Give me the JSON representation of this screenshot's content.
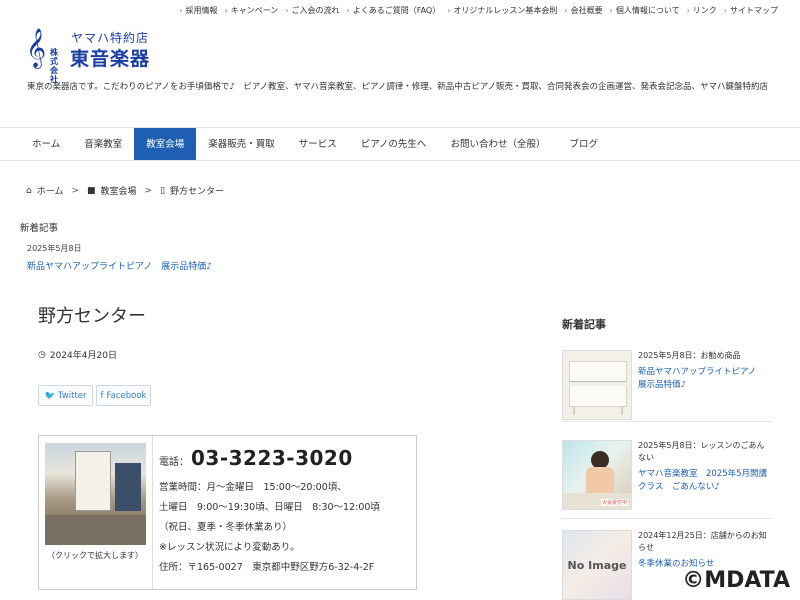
{
  "top_nav": [
    "採用情報",
    "キャンペーン",
    "ご入会の流れ",
    "よくあるご質問（FAQ）",
    "オリジナルレッスン基本会則",
    "会社概要",
    "個人情報について",
    "リンク",
    "サイトマップ"
  ],
  "logo": {
    "subtitle": "ヤマハ特約店",
    "corp": "株式会社",
    "name": "東音楽器"
  },
  "intro": "東京の楽器店です。こだわりのピアノをお手頃価格で♪　ピアノ教室、ヤマハ音楽教室、ピアノ調律・修理、新品中古ピアノ販売・買取、合同発表会の企画運営、発表会記念品、ヤマハ鍵盤特約店",
  "main_nav": [
    "ホーム",
    "音楽教室",
    "教室会場",
    "楽器販売・買取",
    "サービス",
    "ピアノの先生へ",
    "お問い合わせ（全般）",
    "ブログ"
  ],
  "breadcrumb": {
    "home": "ホーム",
    "category": "教室会場",
    "current": "野方センター"
  },
  "news": {
    "title": "新着記事",
    "date": "2025年5月8日",
    "link": "新品ヤマハアップライトピアノ　展示品特価♪"
  },
  "article": {
    "title": "野方センター",
    "date": "2024年4月20日",
    "share_twitter": "Twitter",
    "share_facebook": "Facebook"
  },
  "info": {
    "caption": "（クリックで拡大します）",
    "tel_label": "電話：",
    "tel": "03-3223-3020",
    "lines": [
      "営業時間：月～金曜日　15:00～20:00頃、",
      "土曜日　9:00～19:30頃、日曜日　8:30～12:00頃",
      "（祝日、夏季・冬季休業あり）",
      "※レッスン状況により変動あり。",
      "住所：〒165-0027　東京都中野区野方6-32-4-2F"
    ]
  },
  "sidebar": {
    "title": "新着記事",
    "items": [
      {
        "meta": "2025年5月8日：お勧め商品",
        "link": "新品ヤマハアップライトピアノ　展示品特価♪"
      },
      {
        "meta": "2025年5月8日：レッスンのごあんない",
        "link": "ヤマハ音楽教室　2025年5月開講クラス　ごあんない♪",
        "tag": "大会受付中"
      },
      {
        "meta": "2024年12月25日：店舗からのお知らせ",
        "link": "冬季休業のお知らせ",
        "thumb": "No Image"
      }
    ]
  },
  "watermark": "©MDATA",
  "colors": {
    "accent": "#1e5fb3",
    "logo": "#1b3fa0"
  }
}
